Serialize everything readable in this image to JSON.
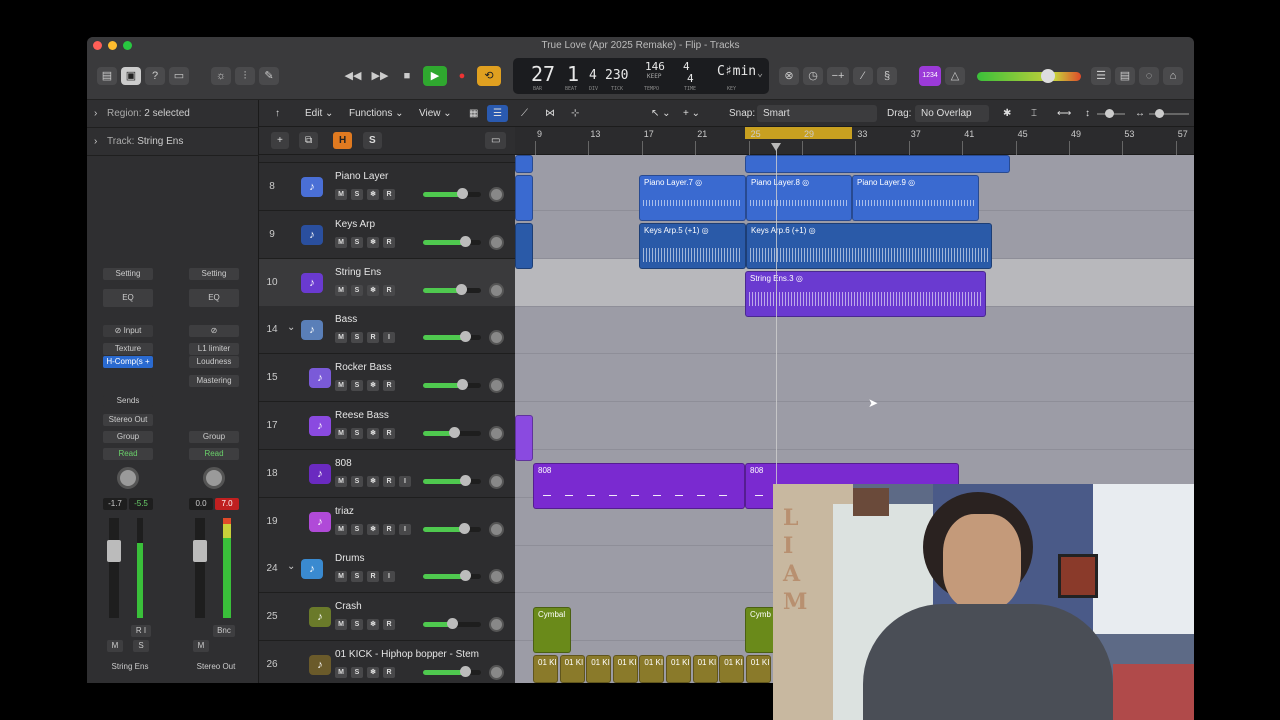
{
  "window": {
    "title": "True Love (Apr 2025 Remake) - Flip - Tracks"
  },
  "lcd": {
    "bar": "27",
    "beat": "1",
    "div": "4",
    "tick": "230",
    "tempo": "146",
    "tempo_sub": "KEEP",
    "time_num": "4",
    "time_den": "4",
    "key": "C♯min",
    "labels": {
      "bar": "BAR",
      "beat": "BEAT",
      "div": "DIV",
      "tick": "TICK",
      "tempo": "TEMPO",
      "time": "TIME",
      "key": "KEY"
    }
  },
  "toolbar": {
    "badge": "1234"
  },
  "inspector": {
    "region": {
      "label": "Region:",
      "value": "2 selected"
    },
    "track": {
      "label": "Track:",
      "value": "String Ens"
    },
    "strip1": {
      "setting": "Setting",
      "eq": "EQ",
      "input": "Input",
      "fx1": "Texture",
      "fx2": "H-Comp(s +",
      "sends": "Sends",
      "out": "Stereo Out",
      "group": "Group",
      "auto": "Read",
      "vol": "-1.7",
      "peak": "-5.5",
      "ri": "R I",
      "m": "M",
      "s": "S",
      "name": "String Ens"
    },
    "strip2": {
      "setting": "Setting",
      "eq": "EQ",
      "fx1": "L1 limiter",
      "fx2": "Loudness",
      "fx3": "Mastering",
      "group": "Group",
      "auto": "Read",
      "vol": "0.0",
      "peak": "7.0",
      "bnc": "Bnc",
      "m": "M",
      "name": "Stereo Out"
    }
  },
  "editbar": {
    "edit": "Edit",
    "functions": "Functions",
    "view": "View",
    "snap_label": "Snap:",
    "snap_value": "Smart",
    "drag_label": "Drag:",
    "drag_value": "No Overlap"
  },
  "header_buttons": {
    "add": "+",
    "h": "H",
    "s": "S"
  },
  "ruler": [
    "9",
    "13",
    "17",
    "21",
    "25",
    "29",
    "33",
    "37",
    "41",
    "45",
    "49",
    "53",
    "57"
  ],
  "tracks": [
    {
      "num": "8",
      "name": "Piano Layer",
      "color": "#4a6fd6",
      "icon": "piano-icon",
      "btns": [
        "M",
        "S",
        "❄",
        "R"
      ],
      "level": 0.68
    },
    {
      "num": "9",
      "name": "Keys Arp",
      "color": "#2a4f9e",
      "icon": "keys-icon",
      "btns": [
        "M",
        "S",
        "❄",
        "R"
      ],
      "level": 0.72
    },
    {
      "num": "10",
      "name": "String Ens",
      "color": "#6a3ad0",
      "icon": "strings-icon",
      "btns": [
        "M",
        "S",
        "❄",
        "R"
      ],
      "level": 0.66
    },
    {
      "num": "14",
      "name": "Bass",
      "color": "#5a7fb8",
      "icon": "bass-folder-icon",
      "btns": [
        "M",
        "S",
        "R",
        "I"
      ],
      "level": 0.72
    },
    {
      "num": "15",
      "name": "Rocker Bass",
      "color": "#7a5ad8",
      "icon": "bass-icon",
      "btns": [
        "M",
        "S",
        "❄",
        "R"
      ],
      "level": 0.68
    },
    {
      "num": "17",
      "name": "Reese Bass",
      "color": "#8a4ae0",
      "icon": "bass-icon",
      "btns": [
        "M",
        "S",
        "❄",
        "R"
      ],
      "level": 0.54
    },
    {
      "num": "18",
      "name": "808",
      "color": "#6a2ac0",
      "icon": "drum-machine-icon",
      "btns": [
        "M",
        "S",
        "❄",
        "R",
        "I"
      ],
      "level": 0.72
    },
    {
      "num": "19",
      "name": "triaz",
      "color": "#b04ad8",
      "icon": "synth-icon",
      "btns": [
        "M",
        "S",
        "❄",
        "R",
        "I"
      ],
      "level": 0.7
    },
    {
      "num": "24",
      "name": "Drums",
      "color": "#3a8ad0",
      "icon": "drums-folder-icon",
      "btns": [
        "M",
        "S",
        "R",
        "I"
      ],
      "level": 0.72
    },
    {
      "num": "25",
      "name": "Crash",
      "color": "#6a7a2a",
      "icon": "cymbal-icon",
      "btns": [
        "M",
        "S",
        "❄",
        "R"
      ],
      "level": 0.5
    },
    {
      "num": "26",
      "name": "01 KICK - Hiphop bopper - Stem",
      "color": "#6a5a2a",
      "icon": "kick-icon",
      "btns": [
        "M",
        "S",
        "❄",
        "R"
      ],
      "level": 0.72
    }
  ],
  "regions": {
    "piano7": "Piano Layer.7",
    "piano8": "Piano Layer.8",
    "piano9": "Piano Layer.9",
    "keys5": "Keys Arp.5 (+1)",
    "keys6": "Keys Arp.6 (+1)",
    "strings3": "String Ens.3",
    "b808a": "808",
    "b808b": "808",
    "cymbal1": "Cymbal",
    "cymbal2": "Cymb",
    "kick": "01 KI"
  },
  "webcam": {
    "sign": "LIAM"
  }
}
